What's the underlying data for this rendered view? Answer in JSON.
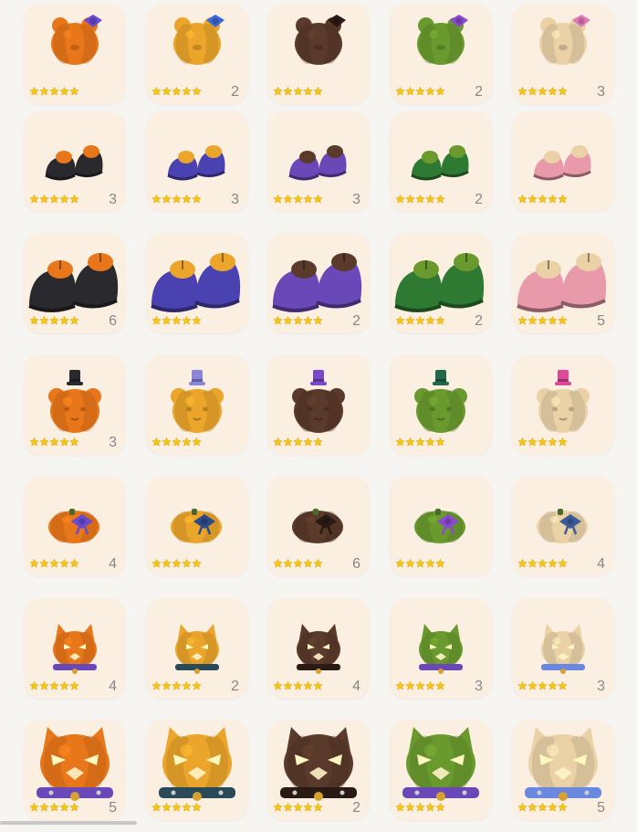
{
  "items": [
    {
      "type": "bear-head-bow",
      "color": "#e8761a",
      "accent": "#6a4ad0",
      "stars": 5,
      "count": ""
    },
    {
      "type": "bear-head-bow",
      "color": "#eaa52a",
      "accent": "#3a6ad8",
      "stars": 5,
      "count": "2"
    },
    {
      "type": "bear-head-bow",
      "color": "#5a3a2a",
      "accent": "#2a1a14",
      "stars": 5,
      "count": ""
    },
    {
      "type": "bear-head-bow",
      "color": "#6a9a2e",
      "accent": "#8a4ad0",
      "stars": 5,
      "count": "2"
    },
    {
      "type": "bear-head-bow",
      "color": "#ead1a6",
      "accent": "#e07ab8",
      "stars": 5,
      "count": "3"
    },
    {
      "type": "shoes-small",
      "color": "#2a2a2e",
      "accent": "#e8761a",
      "stars": 5,
      "count": "3"
    },
    {
      "type": "shoes-small",
      "color": "#4a42b0",
      "accent": "#eaa52a",
      "stars": 5,
      "count": "3"
    },
    {
      "type": "shoes-small",
      "color": "#6a48b8",
      "accent": "#5a3a2a",
      "stars": 5,
      "count": "3"
    },
    {
      "type": "shoes-small",
      "color": "#2e7a32",
      "accent": "#6a9a2e",
      "stars": 5,
      "count": "2"
    },
    {
      "type": "shoes-small",
      "color": "#e89aaa",
      "accent": "#ead1a6",
      "stars": 5,
      "count": ""
    },
    {
      "type": "shoes-large",
      "color": "#2a2a2e",
      "accent": "#e8761a",
      "stars": 5,
      "count": "6"
    },
    {
      "type": "shoes-large",
      "color": "#4a42b0",
      "accent": "#eaa52a",
      "stars": 5,
      "count": ""
    },
    {
      "type": "shoes-large",
      "color": "#6a48b8",
      "accent": "#5a3a2a",
      "stars": 5,
      "count": "2"
    },
    {
      "type": "shoes-large",
      "color": "#2e7a32",
      "accent": "#6a9a2e",
      "stars": 5,
      "count": "2"
    },
    {
      "type": "shoes-large",
      "color": "#e89aaa",
      "accent": "#ead1a6",
      "stars": 5,
      "count": "5"
    },
    {
      "type": "bear-head-hat",
      "color": "#e8761a",
      "accent": "#2a2a2e",
      "stars": 5,
      "count": "3"
    },
    {
      "type": "bear-head-hat",
      "color": "#eaa52a",
      "accent": "#8a86d8",
      "stars": 5,
      "count": ""
    },
    {
      "type": "bear-head-hat",
      "color": "#5a3a2a",
      "accent": "#7a48c8",
      "stars": 5,
      "count": ""
    },
    {
      "type": "bear-head-hat",
      "color": "#6a9a2e",
      "accent": "#1e6a4a",
      "stars": 5,
      "count": ""
    },
    {
      "type": "bear-head-hat",
      "color": "#ead1a6",
      "accent": "#e0489a",
      "stars": 5,
      "count": ""
    },
    {
      "type": "pumpkin-bow",
      "color": "#e8761a",
      "accent": "#6a4ad0",
      "stars": 5,
      "count": "4"
    },
    {
      "type": "pumpkin-bow",
      "color": "#eaa52a",
      "accent": "#2a4a8a",
      "stars": 5,
      "count": ""
    },
    {
      "type": "pumpkin-bow",
      "color": "#5a3a2a",
      "accent": "#2a1a14",
      "stars": 5,
      "count": "6"
    },
    {
      "type": "pumpkin-bow",
      "color": "#6a9a2e",
      "accent": "#8a4ad0",
      "stars": 5,
      "count": ""
    },
    {
      "type": "pumpkin-bow",
      "color": "#ead1a6",
      "accent": "#3a5a9a",
      "stars": 5,
      "count": "4"
    },
    {
      "type": "cat-collar-small",
      "color": "#e8761a",
      "accent": "#6a48b8",
      "stars": 5,
      "count": "4"
    },
    {
      "type": "cat-collar-small",
      "color": "#eaa52a",
      "accent": "#2a4a5a",
      "stars": 5,
      "count": "2"
    },
    {
      "type": "cat-collar-small",
      "color": "#5a3a2a",
      "accent": "#2a1a14",
      "stars": 5,
      "count": "4"
    },
    {
      "type": "cat-collar-small",
      "color": "#6a9a2e",
      "accent": "#6a48b8",
      "stars": 5,
      "count": "3"
    },
    {
      "type": "cat-collar-small",
      "color": "#ead1a6",
      "accent": "#6a88e0",
      "stars": 5,
      "count": "3"
    },
    {
      "type": "cat-collar-large",
      "color": "#e8761a",
      "accent": "#6a48b8",
      "stars": 5,
      "count": "5"
    },
    {
      "type": "cat-collar-large",
      "color": "#eaa52a",
      "accent": "#2a4a5a",
      "stars": 5,
      "count": ""
    },
    {
      "type": "cat-collar-large",
      "color": "#5a3a2a",
      "accent": "#2a1a14",
      "stars": 5,
      "count": "2"
    },
    {
      "type": "cat-collar-large",
      "color": "#6a9a2e",
      "accent": "#6a48b8",
      "stars": 5,
      "count": ""
    },
    {
      "type": "cat-collar-large",
      "color": "#ead1a6",
      "accent": "#6a88e0",
      "stars": 5,
      "count": "5"
    }
  ],
  "colors": {
    "card_background": "#fbefe1",
    "page_background": "#f7f5f2",
    "star": "#f5c518",
    "count_text": "#888888"
  },
  "icons": {
    "star": "star-icon"
  }
}
